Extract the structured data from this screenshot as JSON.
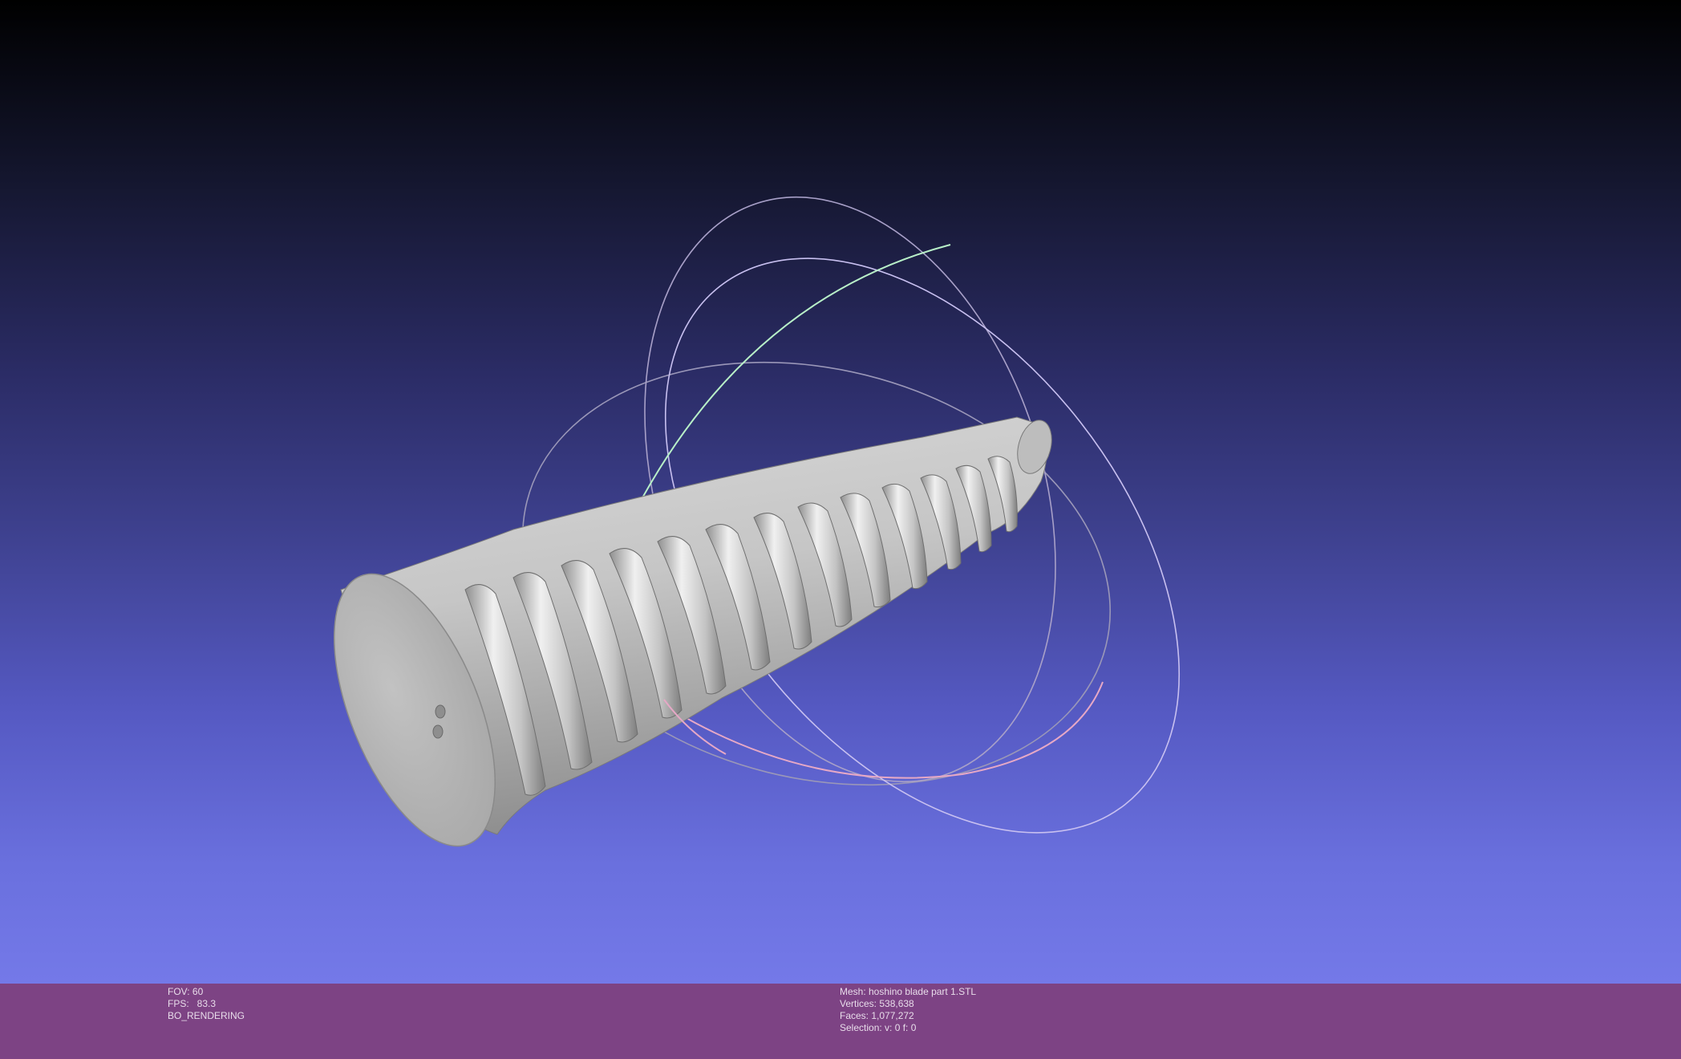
{
  "app": {
    "name": "MeshLab 3D viewport"
  },
  "viewport": {
    "background_top": "#000000",
    "background_bottom": "#7479e8",
    "trackball_colors": {
      "ring_x": "#e6a8c6",
      "ring_y": "#b8f0c8",
      "ring_z": "#c8c0f0",
      "ring_gray": "#9a97b8"
    },
    "mesh_color": "#b8b8b8"
  },
  "info_left": {
    "fov": "FOV: 60",
    "fps": "FPS:   83.3",
    "mode": "BO_RENDERING"
  },
  "info_mesh": {
    "mesh": "Mesh: hoshino blade part 1.STL",
    "vertices": "Vertices: 538,638",
    "faces": "Faces: 1,077,272",
    "selection": "Selection: v: 0 f: 0"
  },
  "info_bar_color": "#7d4384"
}
